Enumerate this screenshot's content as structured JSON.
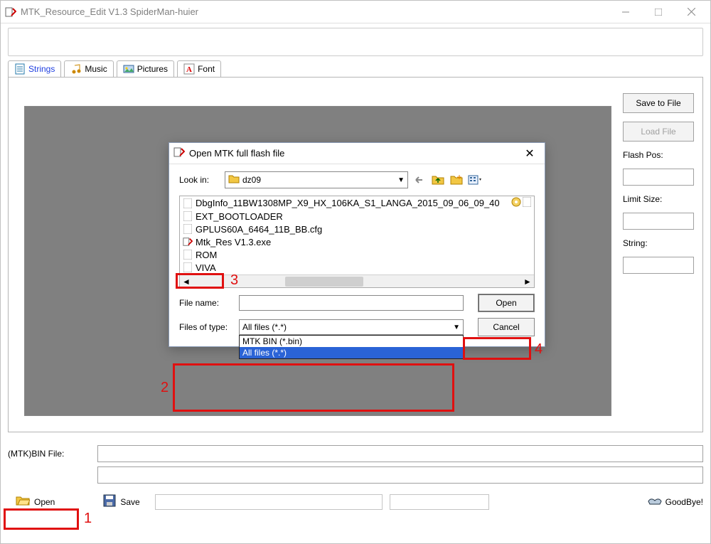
{
  "appTitle": "MTK_Resource_Edit V1.3  SpiderMan-huier",
  "tabs": {
    "strings": "Strings",
    "music": "Music",
    "pictures": "Pictures",
    "font": "Font"
  },
  "side": {
    "saveToFile": "Save to File",
    "loadFile": "Load File",
    "flashPos": "Flash Pos:",
    "limitSize": "Limit Size:",
    "string": "String:"
  },
  "bottom": {
    "mtkBinLabel": "(MTK)BIN File:",
    "open": "Open",
    "save": "Save",
    "goodbye": "GoodBye!"
  },
  "dialog": {
    "title": "Open MTK full flash file",
    "lookInLabel": "Look in:",
    "lookInValue": "dz09",
    "files": [
      "DbgInfo_11BW1308MP_X9_HX_106KA_S1_LANGA_2015_09_06_09_40",
      "EXT_BOOTLOADER",
      "GPLUS60A_6464_11B_BB.cfg",
      "Mtk_Res V1.3.exe",
      "ROM",
      "VIVA"
    ],
    "fileNameLabel": "File name:",
    "filesOfTypeLabel": "Files of type:",
    "filesOfTypeValue": "All files (*.*)",
    "typeOptions": [
      "MTK BIN (*.bin)",
      "All files (*.*)"
    ],
    "open": "Open",
    "cancel": "Cancel"
  },
  "annotations": {
    "a1": "1",
    "a2": "2",
    "a3": "3",
    "a4": "4"
  }
}
